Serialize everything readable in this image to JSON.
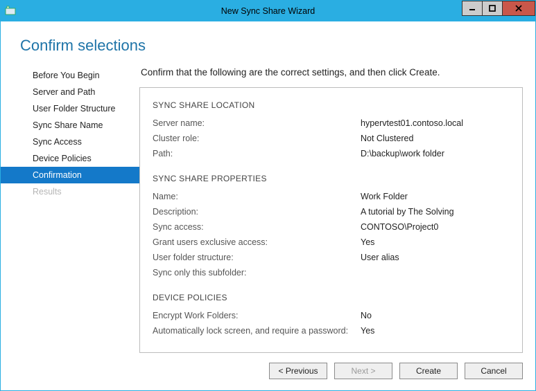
{
  "window": {
    "title": "New Sync Share Wizard",
    "controls": {
      "minimize": "–",
      "maximize": "▢",
      "close": "✕"
    }
  },
  "page": {
    "title": "Confirm selections",
    "instruction": "Confirm that the following are the correct settings, and then click Create."
  },
  "sidebar": {
    "items": [
      {
        "label": "Before You Begin"
      },
      {
        "label": "Server and Path"
      },
      {
        "label": "User Folder Structure"
      },
      {
        "label": "Sync Share Name"
      },
      {
        "label": "Sync Access"
      },
      {
        "label": "Device Policies"
      },
      {
        "label": "Confirmation"
      },
      {
        "label": "Results"
      }
    ]
  },
  "sections": {
    "location": {
      "title": "SYNC SHARE LOCATION",
      "server_name_label": "Server name:",
      "server_name_value": "hypervtest01.contoso.local",
      "cluster_role_label": "Cluster role:",
      "cluster_role_value": "Not Clustered",
      "path_label": "Path:",
      "path_value": "D:\\backup\\work folder"
    },
    "properties": {
      "title": "SYNC SHARE PROPERTIES",
      "name_label": "Name:",
      "name_value": "Work Folder",
      "description_label": "Description:",
      "description_value": "A tutorial by The Solving",
      "sync_access_label": "Sync access:",
      "sync_access_value": "CONTOSO\\Project0",
      "exclusive_label": "Grant users exclusive access:",
      "exclusive_value": "Yes",
      "folder_structure_label": "User folder structure:",
      "folder_structure_value": "User alias",
      "subfolder_label": "Sync only this subfolder:",
      "subfolder_value": ""
    },
    "policies": {
      "title": "DEVICE POLICIES",
      "encrypt_label": "Encrypt Work Folders:",
      "encrypt_value": "No",
      "lock_label": "Automatically lock screen, and require a password:",
      "lock_value": "Yes"
    }
  },
  "footer": {
    "previous": "< Previous",
    "next": "Next >",
    "create": "Create",
    "cancel": "Cancel"
  }
}
